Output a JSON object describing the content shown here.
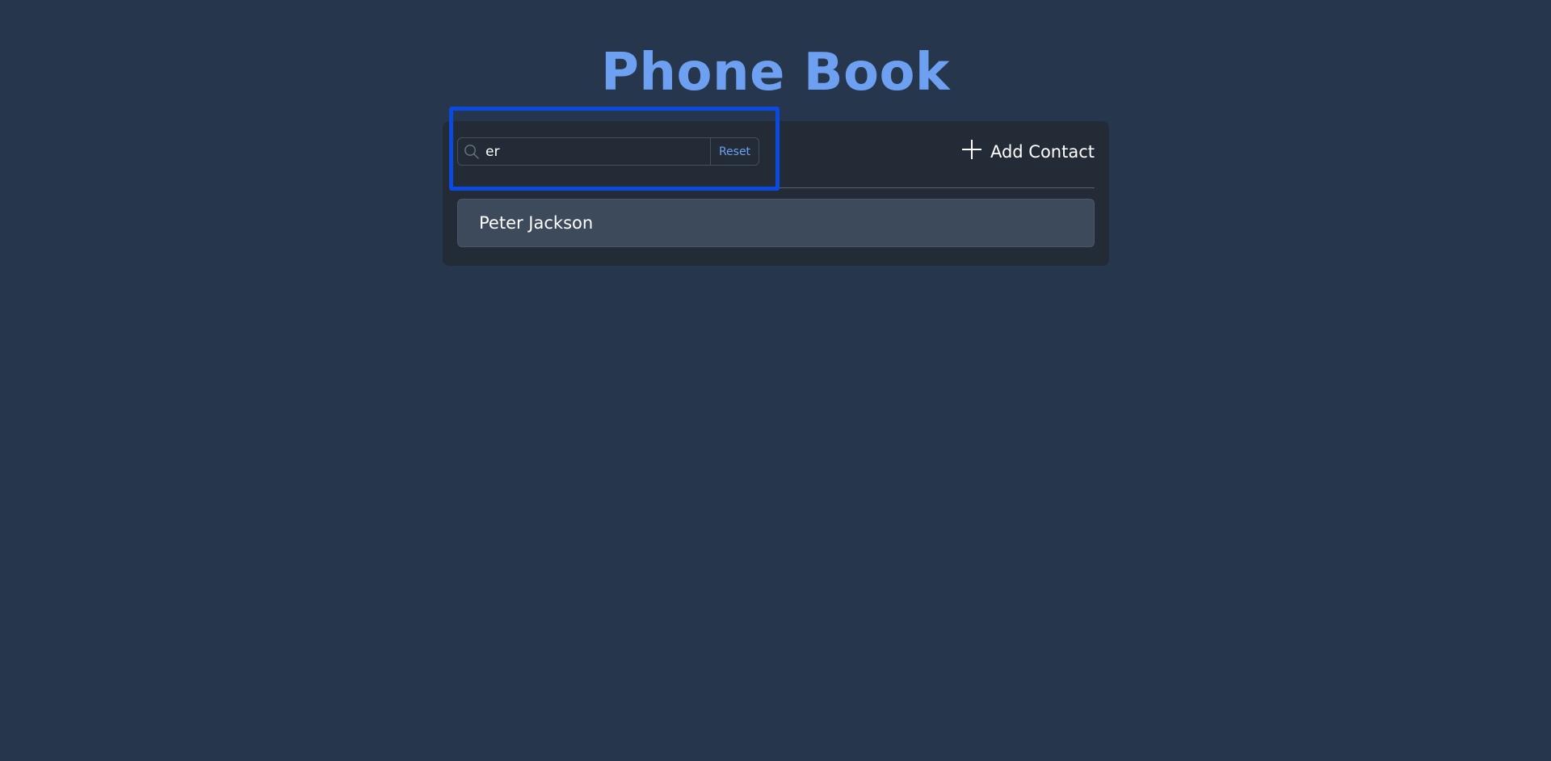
{
  "app": {
    "title": "Phone Book"
  },
  "search": {
    "value": "er",
    "placeholder": "",
    "icon": "search-icon",
    "reset_label": "Reset"
  },
  "toolbar": {
    "add_contact_label": "Add Contact",
    "add_icon": "plus-icon"
  },
  "contacts": [
    {
      "name": "Peter Jackson"
    }
  ],
  "colors": {
    "background": "#25364d",
    "card": "#232b37",
    "accent": "#6ea0f2",
    "contact_row": "#3c4a5c",
    "highlight": "#0a4ae0"
  }
}
